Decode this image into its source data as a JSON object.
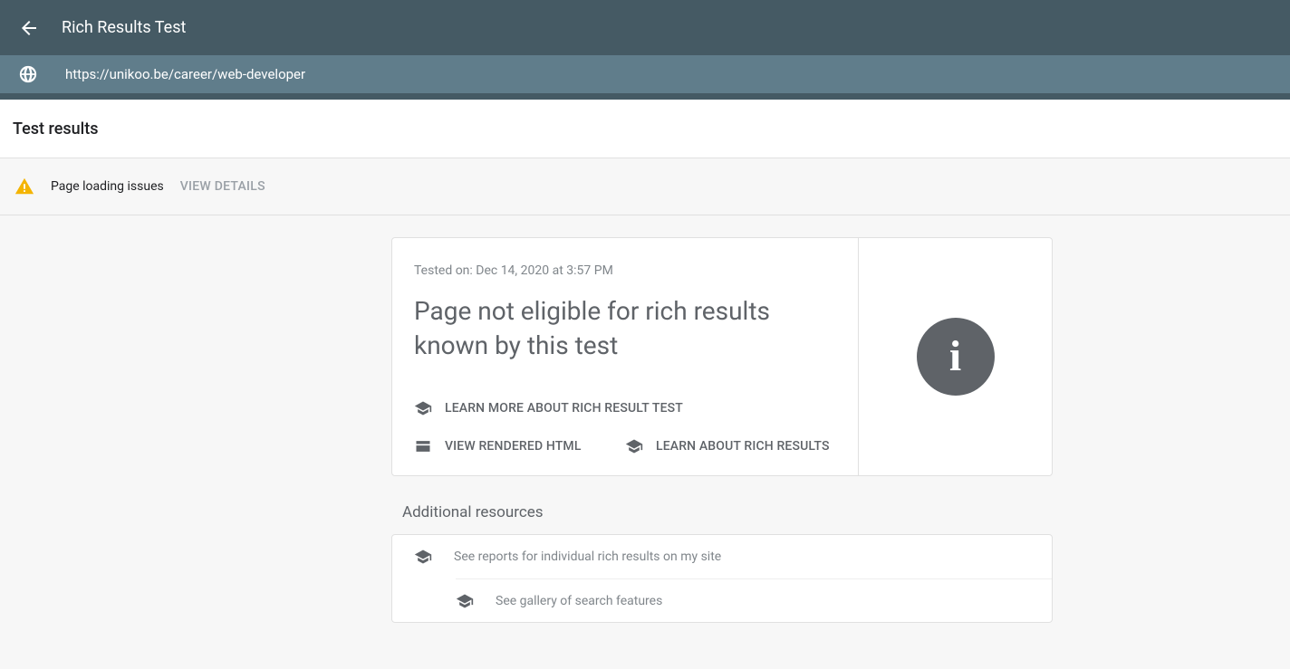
{
  "header": {
    "title": "Rich Results Test"
  },
  "urlbar": {
    "url": "https://unikoo.be/career/web-developer"
  },
  "results": {
    "heading": "Test results"
  },
  "issues": {
    "text": "Page loading issues",
    "view_details": "VIEW DETAILS"
  },
  "main": {
    "tested_on": "Tested on: Dec 14, 2020 at 3:57 PM",
    "title": "Page not eligible for rich results known by this test",
    "links": {
      "learn_more": "LEARN MORE ABOUT RICH RESULT TEST",
      "view_rendered": "VIEW RENDERED HTML",
      "learn_results": "LEARN ABOUT RICH RESULTS"
    }
  },
  "resources": {
    "heading": "Additional resources",
    "items": [
      "See reports for individual rich results on my site",
      "See gallery of search features"
    ]
  }
}
